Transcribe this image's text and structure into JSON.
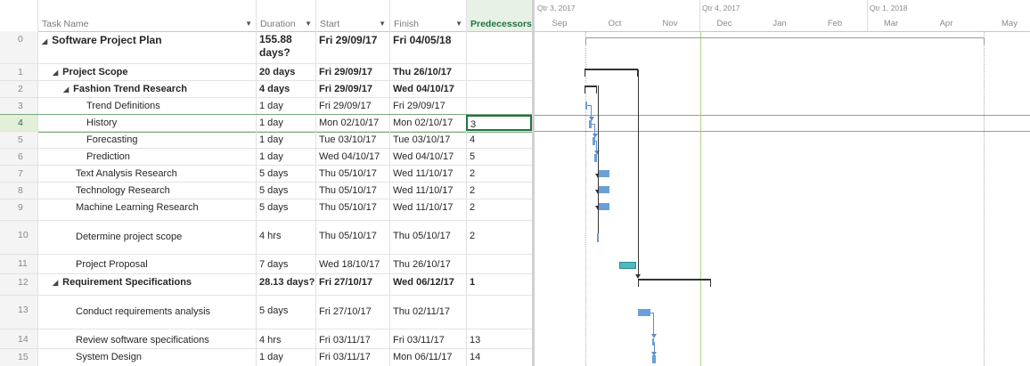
{
  "columns": {
    "name": "Task Name",
    "duration": "Duration",
    "start": "Start",
    "finish": "Finish",
    "predecessors": "Predecessors"
  },
  "timescale": {
    "quarters": [
      "Qtr 3, 2017",
      "Qtr 4, 2017",
      "Qtr 1, 2018"
    ],
    "months": [
      "Sep",
      "Oct",
      "Nov",
      "Dec",
      "Jan",
      "Feb",
      "Mar",
      "Apr",
      "May"
    ]
  },
  "rows": [
    {
      "id": "0",
      "name": "Software Project Plan",
      "duration": "155.88 days?",
      "start": "Fri 29/09/17",
      "finish": "Fri 04/05/18",
      "pred": ""
    },
    {
      "id": "1",
      "name": "Project Scope",
      "duration": "20 days",
      "start": "Fri 29/09/17",
      "finish": "Thu 26/10/17",
      "pred": ""
    },
    {
      "id": "2",
      "name": "Fashion Trend Research",
      "duration": "4 days",
      "start": "Fri 29/09/17",
      "finish": "Wed 04/10/17",
      "pred": ""
    },
    {
      "id": "3",
      "name": "Trend Definitions",
      "duration": "1 day",
      "start": "Fri 29/09/17",
      "finish": "Fri 29/09/17",
      "pred": ""
    },
    {
      "id": "4",
      "name": "History",
      "duration": "1 day",
      "start": "Mon 02/10/17",
      "finish": "Mon 02/10/17",
      "pred": "3"
    },
    {
      "id": "5",
      "name": "Forecasting",
      "duration": "1 day",
      "start": "Tue 03/10/17",
      "finish": "Tue 03/10/17",
      "pred": "4"
    },
    {
      "id": "6",
      "name": "Prediction",
      "duration": "1 day",
      "start": "Wed 04/10/17",
      "finish": "Wed 04/10/17",
      "pred": "5"
    },
    {
      "id": "7",
      "name": "Text Analysis Research",
      "duration": "5 days",
      "start": "Thu 05/10/17",
      "finish": "Wed 11/10/17",
      "pred": "2"
    },
    {
      "id": "8",
      "name": "Technology Research",
      "duration": "5 days",
      "start": "Thu 05/10/17",
      "finish": "Wed 11/10/17",
      "pred": "2"
    },
    {
      "id": "9",
      "name": "Machine Learning Research",
      "duration": "5 days",
      "start": "Thu 05/10/17",
      "finish": "Wed 11/10/17",
      "pred": "2"
    },
    {
      "id": "10",
      "name": "Determine project scope",
      "duration": "4 hrs",
      "start": "Thu 05/10/17",
      "finish": "Thu 05/10/17",
      "pred": "2"
    },
    {
      "id": "11",
      "name": "Project Proposal",
      "duration": "7 days",
      "start": "Wed 18/10/17",
      "finish": "Thu 26/10/17",
      "pred": ""
    },
    {
      "id": "12",
      "name": "Requirement Specifications",
      "duration": "28.13 days?",
      "start": "Fri 27/10/17",
      "finish": "Wed 06/12/17",
      "pred": "1"
    },
    {
      "id": "13",
      "name": "Conduct requirements analysis",
      "duration": "5 days",
      "start": "Fri 27/10/17",
      "finish": "Thu 02/11/17",
      "pred": ""
    },
    {
      "id": "14",
      "name": "Review software specifications",
      "duration": "4 hrs",
      "start": "Fri 03/11/17",
      "finish": "Fri 03/11/17",
      "pred": "13"
    },
    {
      "id": "15",
      "name": "System Design",
      "duration": "1 day",
      "start": "Fri 03/11/17",
      "finish": "Mon 06/11/17",
      "pred": "14"
    }
  ],
  "colors": {
    "summary": "#333333",
    "task_bar": "#6a9fd8",
    "critical_bar": "#4fb9c0",
    "selection": "#217346",
    "today_line": "#a9d08e"
  }
}
